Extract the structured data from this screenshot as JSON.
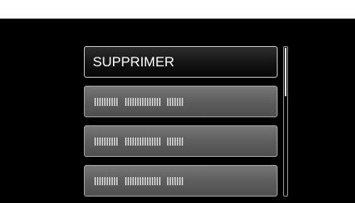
{
  "menu": {
    "items": [
      {
        "label": "SUPPRIMER",
        "selected": true
      },
      {
        "label": "",
        "selected": false,
        "obscured": true
      },
      {
        "label": "",
        "selected": false,
        "obscured": true
      },
      {
        "label": "",
        "selected": false,
        "obscured": true
      }
    ]
  },
  "scrollbar": {
    "position_fraction": 0.0,
    "visible_fraction": 0.33
  },
  "colors": {
    "background": "#000000",
    "selected_item": "#141414",
    "normal_item": "#5e5e5e",
    "item_border": "#a9a9a9",
    "label_text": "#ffffff",
    "top_strip": "#ffffff"
  }
}
